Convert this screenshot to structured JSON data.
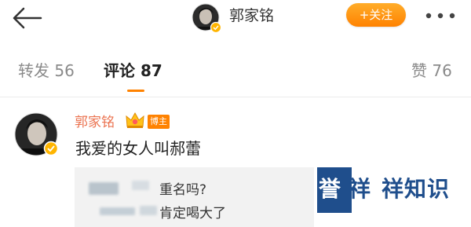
{
  "header": {
    "profile_name": "郭家铭",
    "follow_label": "+关注"
  },
  "tabs": {
    "repost_label": "转发",
    "repost_count": "56",
    "comment_label": "评论",
    "comment_count": "87",
    "like_label": "赞",
    "like_count": "76"
  },
  "comment": {
    "author": "郭家铭",
    "badge": "博主",
    "text": "我爱的女人叫郝蕾"
  },
  "replies": [
    {
      "text": "重名吗?"
    },
    {
      "text": "肯定喝大了"
    }
  ],
  "watermark": {
    "part1": "誉",
    "part2": "祥",
    "part3": "祥知识"
  },
  "colors": {
    "accent": "#ff8200",
    "username": "#eb7350",
    "watermark": "#1f4e8c"
  },
  "icons": {
    "back": "back-arrow-icon",
    "more": "more-dots-icon",
    "verified": "verified-badge-icon",
    "crown": "crown-icon"
  }
}
